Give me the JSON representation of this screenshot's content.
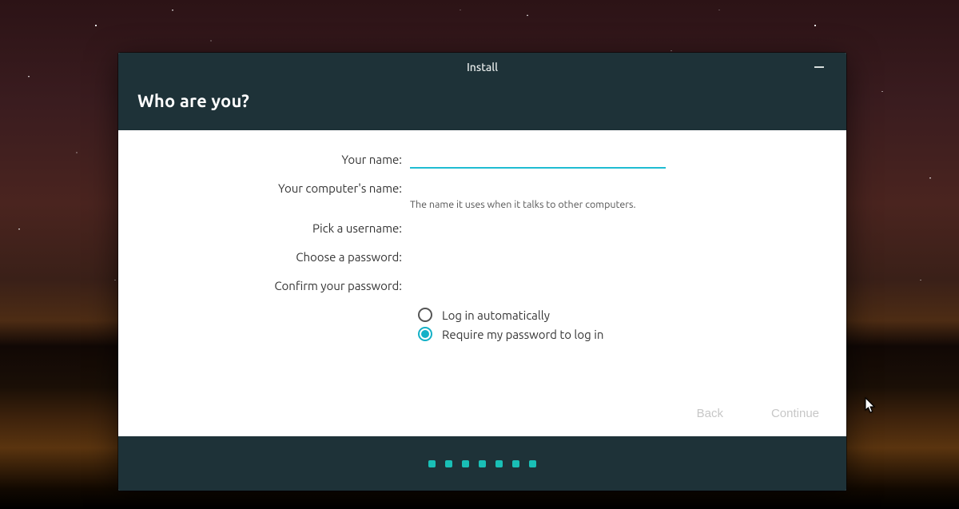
{
  "accent_color": "#14b1c7",
  "window": {
    "title": "Install",
    "heading": "Who are you?"
  },
  "form": {
    "name": {
      "label": "Your name:",
      "value": ""
    },
    "hostname": {
      "label": "Your computer's name:",
      "value": "",
      "hint": "The name it uses when it talks to other computers."
    },
    "username": {
      "label": "Pick a username:",
      "value": ""
    },
    "password": {
      "label": "Choose a password:",
      "value": ""
    },
    "confirm": {
      "label": "Confirm your password:",
      "value": ""
    },
    "login_options": {
      "selected_index": 1,
      "items": [
        "Log in automatically",
        "Require my password to log in"
      ]
    }
  },
  "buttons": {
    "back": "Back",
    "continue": "Continue"
  },
  "progress_dots": 7
}
